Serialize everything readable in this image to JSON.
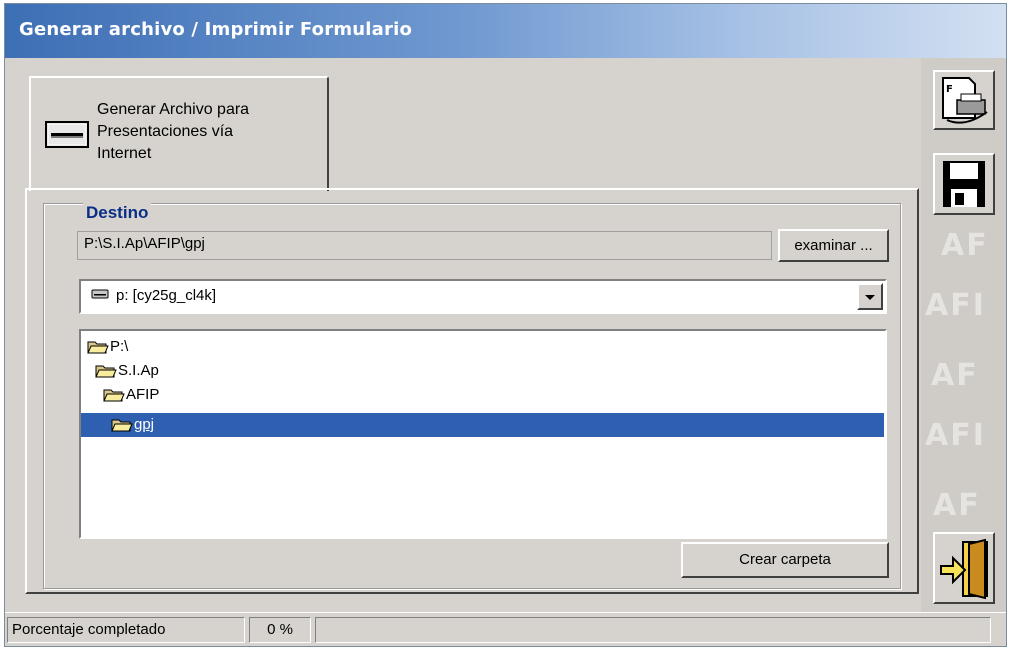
{
  "window": {
    "title": "Generar archivo / Imprimir Formulario"
  },
  "tab": {
    "label": "Generar Archivo para\nPresentaciones vía\nInternet",
    "icon": "drive-icon"
  },
  "destino": {
    "title": "Destino",
    "path_value": "P:\\S.I.Ap\\AFIP\\gpj",
    "browse_label": "examinar ...",
    "drive_select": "p: [cy25g_cl4k]",
    "folders": [
      {
        "name": "P:\\",
        "selected": false
      },
      {
        "name": "S.I.Ap",
        "selected": false
      },
      {
        "name": "AFIP",
        "selected": false
      },
      {
        "name": "gpj",
        "selected": true
      }
    ],
    "create_folder_label": "Crear carpeta"
  },
  "sidebar": {
    "buttons": [
      {
        "name": "print-form-button",
        "icon": "printer-icon"
      },
      {
        "name": "save-button",
        "icon": "floppy-disk-icon"
      },
      {
        "name": "exit-button",
        "icon": "exit-door-icon"
      }
    ]
  },
  "status": {
    "label": "Porcentaje completado",
    "percent": "0 %",
    "percent_value": 0
  },
  "colors": {
    "title_start": "#3d6fb5",
    "selection": "#2f5fb0",
    "group_title": "#0a2d87",
    "face": "#d6d3ce"
  }
}
